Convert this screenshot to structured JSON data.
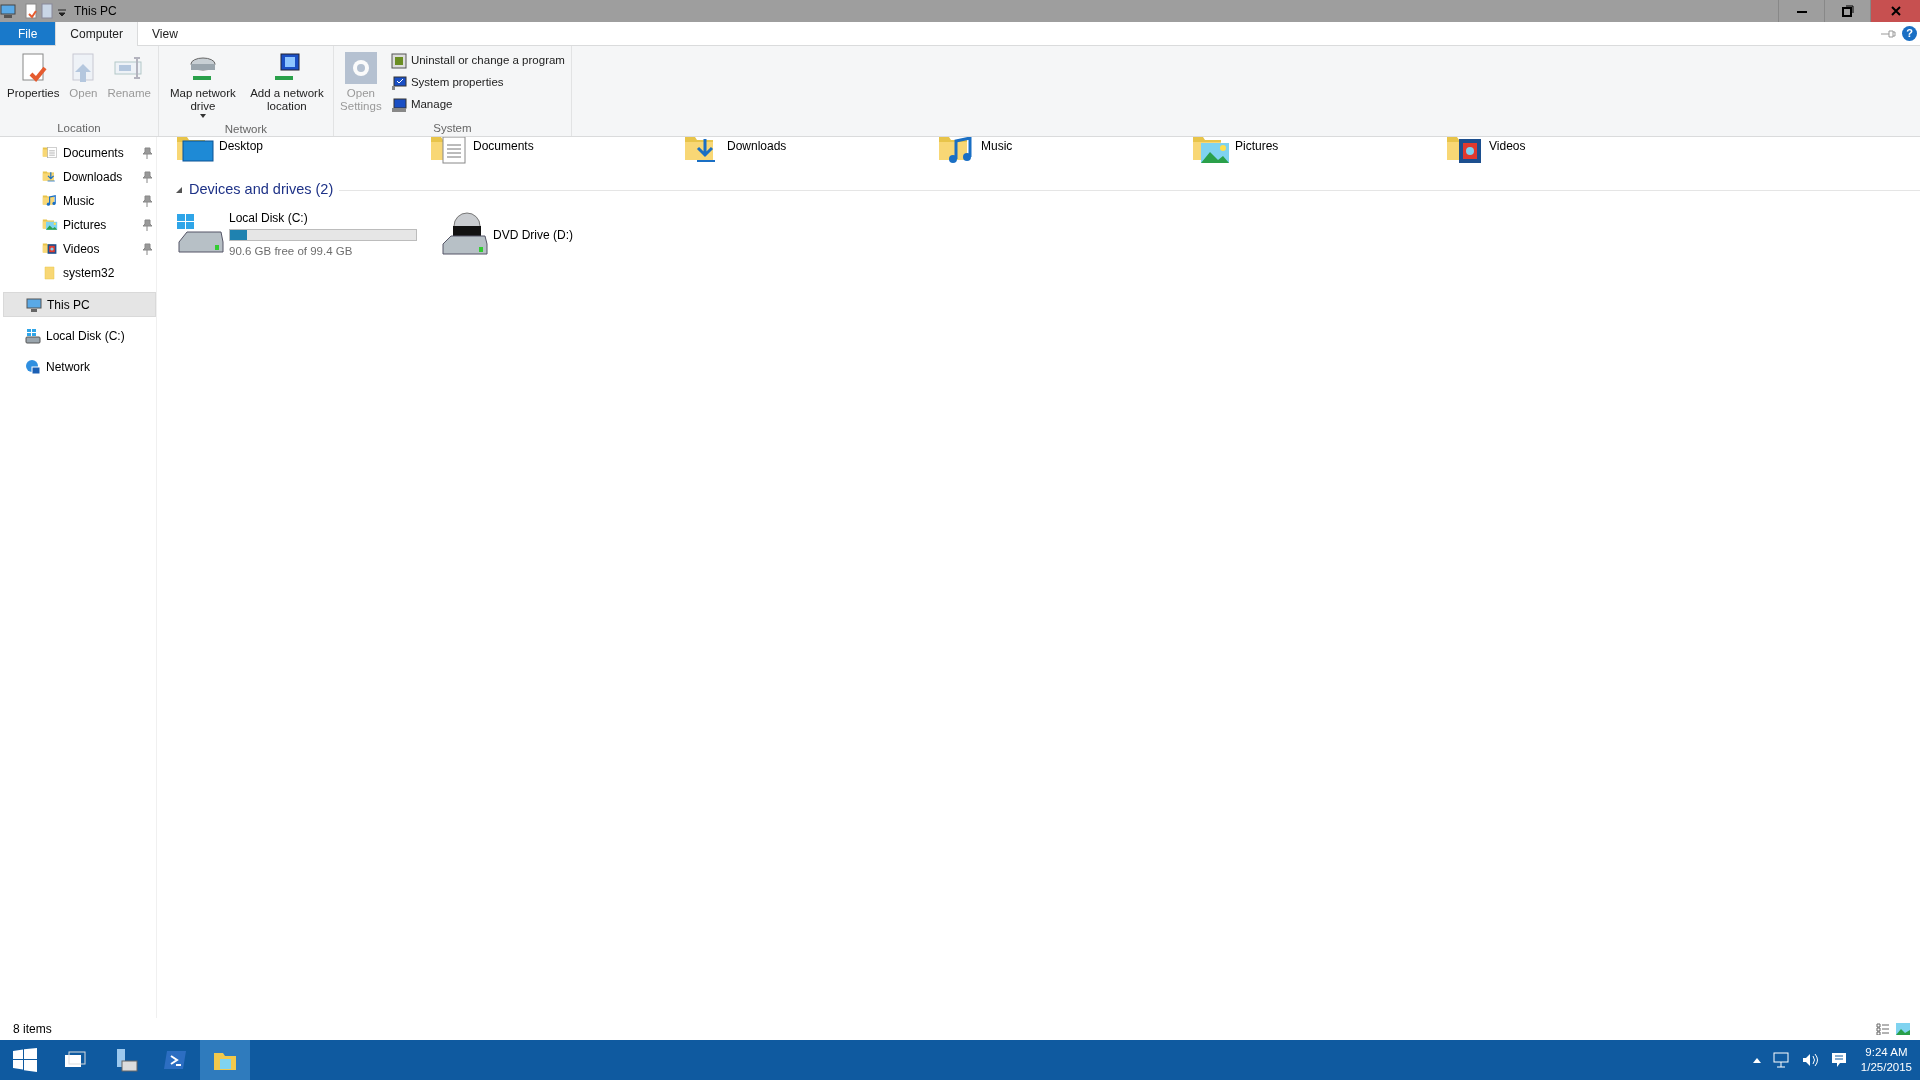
{
  "window": {
    "title": "This PC"
  },
  "ribbon_tabs": [
    {
      "label": "File",
      "kind": "file",
      "selected": false
    },
    {
      "label": "Computer",
      "kind": "tab",
      "selected": true
    },
    {
      "label": "View",
      "kind": "tab",
      "selected": false
    }
  ],
  "help_button": "?",
  "ribbon_groups": [
    {
      "label": "Location",
      "buttons": [
        {
          "label": "Properties",
          "disabled": false
        },
        {
          "label": "Open",
          "disabled": true
        },
        {
          "label": "Rename",
          "disabled": true
        }
      ]
    },
    {
      "label": "Network",
      "buttons": [
        {
          "label": "Map network drive",
          "disabled": false,
          "dropdown": true
        },
        {
          "label": "Add a network location",
          "disabled": false
        }
      ]
    },
    {
      "label": "System",
      "buttons": [
        {
          "label": "Open Settings",
          "disabled": true
        }
      ],
      "small_buttons": [
        {
          "label": "Uninstall or change a program"
        },
        {
          "label": "System properties"
        },
        {
          "label": "Manage"
        }
      ]
    }
  ],
  "nav": {
    "quick_access": [
      {
        "label": "Documents",
        "kind": "documents",
        "pinned": true
      },
      {
        "label": "Downloads",
        "kind": "downloads",
        "pinned": true
      },
      {
        "label": "Music",
        "kind": "music",
        "pinned": true
      },
      {
        "label": "Pictures",
        "kind": "pictures",
        "pinned": true
      },
      {
        "label": "Videos",
        "kind": "videos",
        "pinned": true
      },
      {
        "label": "system32",
        "kind": "folder",
        "pinned": false
      }
    ],
    "items": [
      {
        "label": "This PC",
        "kind": "pc",
        "selected": true
      },
      {
        "label": "Local Disk (C:)",
        "kind": "disk",
        "selected": false
      },
      {
        "label": "Network",
        "kind": "network",
        "selected": false
      }
    ]
  },
  "folders": [
    {
      "label": "Desktop",
      "kind": "desktop"
    },
    {
      "label": "Documents",
      "kind": "documents"
    },
    {
      "label": "Downloads",
      "kind": "downloads"
    },
    {
      "label": "Music",
      "kind": "music"
    },
    {
      "label": "Pictures",
      "kind": "pictures"
    },
    {
      "label": "Videos",
      "kind": "videos"
    }
  ],
  "devices_group": {
    "label": "Devices and drives (2)",
    "expanded": true,
    "drives": [
      {
        "label": "Local Disk (C:)",
        "kind": "hdd",
        "level": 0.09,
        "detail": "90.6 GB free of 99.4 GB"
      },
      {
        "label": "DVD Drive (D:)",
        "kind": "dvd"
      }
    ]
  },
  "status_bar": {
    "text": "8 items"
  },
  "taskbar": {
    "time": "9:24 AM",
    "date": "1/25/2015"
  }
}
